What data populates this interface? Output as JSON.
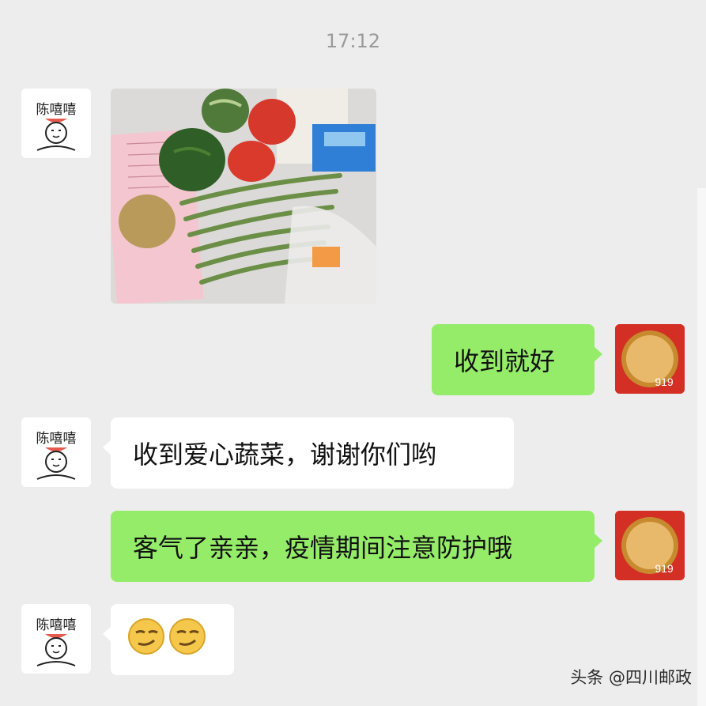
{
  "chat": {
    "timestamp": "17:12",
    "contact": {
      "avatar_text": "陈嘻嘻"
    },
    "self": {
      "avatar_badge": "919"
    },
    "messages": [
      {
        "side": "in",
        "type": "image",
        "content": "蔬菜照片"
      },
      {
        "side": "out",
        "type": "text",
        "text": "收到就好"
      },
      {
        "side": "in",
        "type": "text",
        "text": "收到爱心蔬菜，谢谢你们哟"
      },
      {
        "side": "out",
        "type": "text",
        "text": "客气了亲亲，疫情期间注意防护哦"
      },
      {
        "side": "in",
        "type": "emoji",
        "emojis": [
          "smirk-emoji",
          "smirk-emoji"
        ]
      }
    ]
  },
  "watermark": "头条 @四川邮政",
  "colors": {
    "background": "#ededed",
    "incoming_bubble": "#ffffff",
    "outgoing_bubble": "#95ec69",
    "timestamp": "#9a9a9a",
    "self_avatar": "#d42f24"
  }
}
